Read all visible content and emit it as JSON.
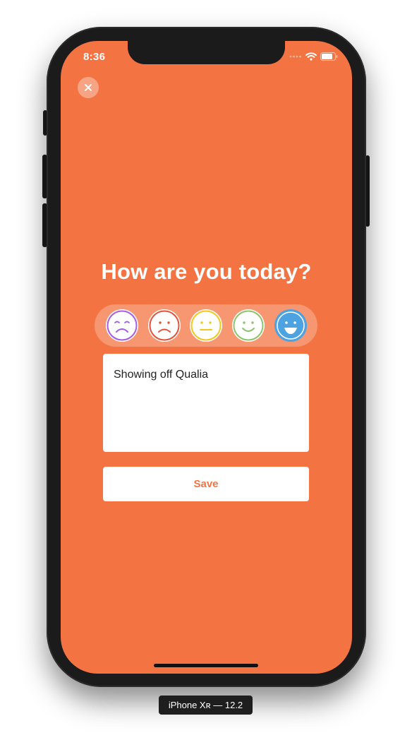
{
  "status_bar": {
    "time": "8:36"
  },
  "close": {
    "icon": "close-icon"
  },
  "prompt": {
    "title": "How are you today?"
  },
  "moods": [
    {
      "name": "very-sad",
      "icon": "very-sad-face-icon",
      "color": "#A55CE6",
      "selected": false
    },
    {
      "name": "sad",
      "icon": "sad-face-icon",
      "color": "#E2533A",
      "selected": false
    },
    {
      "name": "neutral",
      "icon": "neutral-face-icon",
      "color": "#F2C81C",
      "selected": false
    },
    {
      "name": "happy",
      "icon": "happy-face-icon",
      "color": "#8CC46A",
      "selected": false
    },
    {
      "name": "very-happy",
      "icon": "very-happy-face-icon",
      "color": "#4DA3E2",
      "selected": true
    }
  ],
  "note": {
    "value": "Showing off Qualia"
  },
  "save": {
    "label": "Save"
  },
  "simulator": {
    "device_label": "iPhone Xʀ — 12.2"
  },
  "colors": {
    "background": "#F37442",
    "accent": "#F37442"
  }
}
